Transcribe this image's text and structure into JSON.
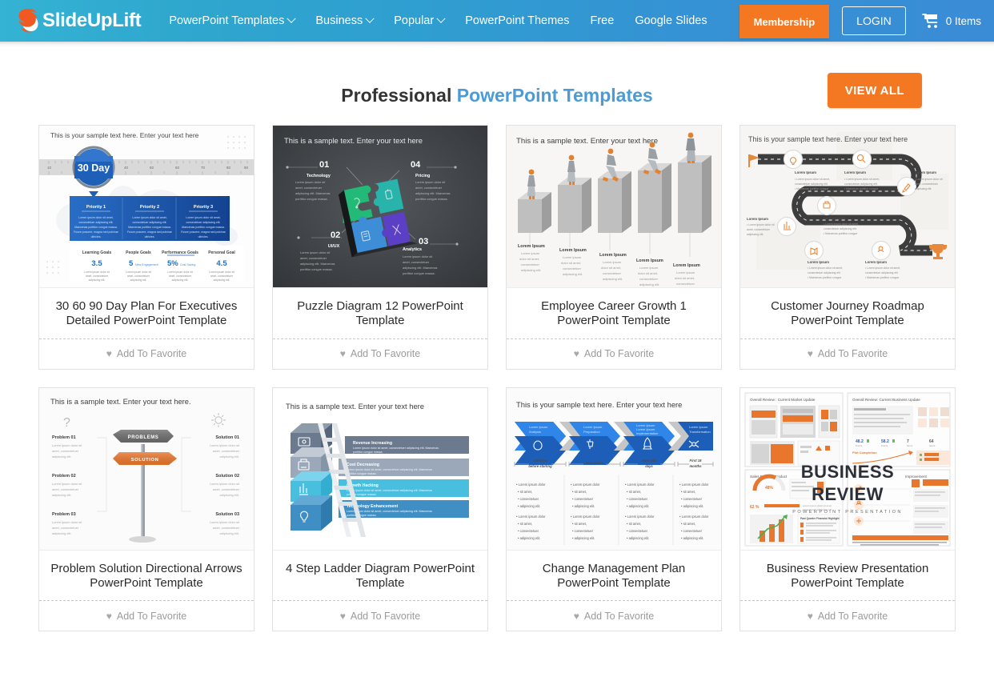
{
  "header": {
    "brand_name": "SlideUpLift",
    "brand_logo_icon": "slideuplift-swoosh-logo-icon",
    "nav": [
      {
        "label": "PowerPoint Templates",
        "has_caret": true
      },
      {
        "label": "Business",
        "has_caret": true
      },
      {
        "label": "Popular",
        "has_caret": true
      },
      {
        "label": "PowerPoint Themes",
        "has_caret": false
      },
      {
        "label": "Free",
        "has_caret": false
      },
      {
        "label": "Google Slides",
        "has_caret": false
      }
    ],
    "membership_label": "Membership",
    "login_label": "LOGIN",
    "cart_icon": "shopping-cart-icon",
    "cart_label": "0 Items",
    "colors": {
      "gradient_start": "#34b3d4",
      "gradient_end": "#3a8cd6",
      "accent_orange": "#f47721"
    }
  },
  "section": {
    "title_plain": "Professional ",
    "title_accent": "PowerPoint Templates",
    "view_all_label": "VIEW ALL",
    "favorite_label": "Add To Favorite",
    "favorite_icon": "heart-icon"
  },
  "cards": [
    {
      "title": "30 60 90 Day Plan For Executives Detailed PowerPoint Template",
      "thumb_kind": "day-plan-30-60-90",
      "thumb": {
        "heading": "This is your sample text here. Enter your text here",
        "badge": "30 Day",
        "ruler_ticks": [
          "10",
          "20",
          "30",
          "40",
          "50",
          "60",
          "70",
          "80",
          "90"
        ],
        "priorities": [
          "Priority 1",
          "Priority 2",
          "Priority 3"
        ],
        "priority_body": "Lorem ipsum dolor sit amet, consectetur adipiscing elit. Maecenas porttitor congue massa. Fusce posuere, magna sed pulvinar ultricies.",
        "goal_labels": [
          "Learning Goals",
          "People Goals",
          "Performance Goals",
          "Personal Goal"
        ],
        "goal_values": [
          "3.5",
          "5",
          "5%",
          "4.5"
        ],
        "goal_value_notes": [
          "",
          "New Engagement",
          "Cost Savings",
          ""
        ],
        "goal_body": "Lorem ipsum dolor sit amet, consectetur adipiscing elit."
      }
    },
    {
      "title": "Puzzle Diagram 12 PowerPoint Template",
      "thumb_kind": "puzzle-diagram",
      "thumb": {
        "heading": "This is a sample text. Enter your text here",
        "items": [
          {
            "num": "01",
            "label": "Technology"
          },
          {
            "num": "04",
            "label": "Pricing"
          },
          {
            "num": "02",
            "label": "UI/UX"
          },
          {
            "num": "03",
            "label": "Analytics"
          }
        ],
        "body": "Lorem ipsum dolor sit amet, consectetur adipiscing elit. Maecenas porttitor congue massa.",
        "piece_colors": [
          "#22bb77",
          "#2bb5ab",
          "#3d8fd0",
          "#5a3fbf"
        ]
      }
    },
    {
      "title": "Employee Career Growth 1 PowerPoint Template",
      "thumb_kind": "career-growth-steps",
      "thumb": {
        "heading": "This is a sample text. Enter your text here",
        "captions": [
          "Lorem Ipsum",
          "Lorem Ipsum",
          "Lorem Ipsum",
          "Lorem Ipsum",
          "Lorem Ipsum"
        ],
        "body": "Lorem ipsum dolor sit amet, consectetuer adipiscing elit.",
        "figure_color": "#e0822f",
        "step_count": 5
      }
    },
    {
      "title": "Customer Journey Roadmap PowerPoint Template",
      "thumb_kind": "customer-journey-roadmap",
      "thumb": {
        "heading": "This is your sample text here. Enter your text here",
        "node_icons": [
          "lightbulb-icon",
          "magnifier-icon",
          "pen-icon",
          "briefcase-icon",
          "chart-icon",
          "megaphone-icon",
          "handshake-icon"
        ],
        "flag_icon": "flag-icon",
        "trophy_icon": "trophy-icon",
        "caption_title": "Lorem Ipsum",
        "caption_body": "Lorem ipsum dolor sit amet, consectetuer adipiscing elit. Maecenas porttitor congue.",
        "road_color": "#3d3d3d",
        "accent": "#e8883a"
      }
    },
    {
      "title": "Problem Solution Directional Arrows PowerPoint Template",
      "thumb_kind": "problem-solution-signpost",
      "thumb": {
        "heading": "This is a sample text. Enter your text here.",
        "sign_labels": [
          "PROBLEMS",
          "SOLUTION"
        ],
        "left_items": [
          "Problem 01",
          "Problem 02",
          "Problem 03"
        ],
        "right_items": [
          "Solution 01",
          "Solution 02",
          "Solution 03"
        ],
        "body": "Lorem ipsum dolor sit amet, consectetuer adipiscing elit.",
        "left_icon": "question-mark-icon",
        "right_icon": "lightbulb-icon",
        "problem_color": "#6b6b6b",
        "solution_color": "#e8762d"
      }
    },
    {
      "title": "4 Step Ladder Diagram PowerPoint Template",
      "thumb_kind": "ladder-diagram-4-step",
      "thumb": {
        "heading": "This is a sample text. Enter your text here",
        "steps": [
          {
            "label": "Revenue Increasing",
            "icon": "wallet-icon",
            "color": "#6b7a8f"
          },
          {
            "label": "Cost Decreasing",
            "icon": "printer-icon",
            "color": "#9aa8ba"
          },
          {
            "label": "Growth Hacking",
            "icon": "bar-chart-icon",
            "color": "#49bfe0"
          },
          {
            "label": "Technology Enhancement",
            "icon": "lightbulb-icon",
            "color": "#3f8fc4"
          }
        ],
        "body": "Lorem ipsum dolor sit amet, consectetur adipiscing elit. Maecenas porttitor congue massa."
      }
    },
    {
      "title": "Change Management Plan PowerPoint Template",
      "thumb_kind": "change-management-chevrons",
      "thumb": {
        "heading": "This is your sample text here. Enter your text here",
        "chevron_titles": [
          "Lorem Ipsum Analysis",
          "Lorem Ipsum Preparation",
          "Lorem Ipsum Lorem Ipsum Implementation",
          "Lorem Ipsum Transformation"
        ],
        "chevron_icons": [
          "hand-icon",
          "person-icon",
          "rocket-icon",
          "network-icon"
        ],
        "timeline": [
          "180 days before starting",
          "First weeks",
          "First 180 days",
          "First 18 months"
        ],
        "bullets": [
          "Lorem ipsum dolor",
          "sit amet,",
          "consectetuer",
          "adipiscing elit."
        ],
        "chevron_color": "#1f6fd0",
        "chevron_top_color": "#2f85e8"
      }
    },
    {
      "title": "Business Review Presentation PowerPoint Template",
      "thumb_kind": "business-review-collage",
      "thumb": {
        "big_title_line1": "BUSINESS",
        "big_title_line2": "REVIEW",
        "subtitle": "POWERPOINT PRESENTATION",
        "mini_titles": [
          "Overall Review : Current Market Update",
          "Overall Review: Current Business Update",
          "Sales Review: Product",
          "Improvement"
        ],
        "metrics": [
          "48.2",
          "58.2",
          "7",
          "64"
        ],
        "gauge_value": "48%",
        "progress_value": "62 %",
        "accent": "#e8762d"
      }
    }
  ]
}
